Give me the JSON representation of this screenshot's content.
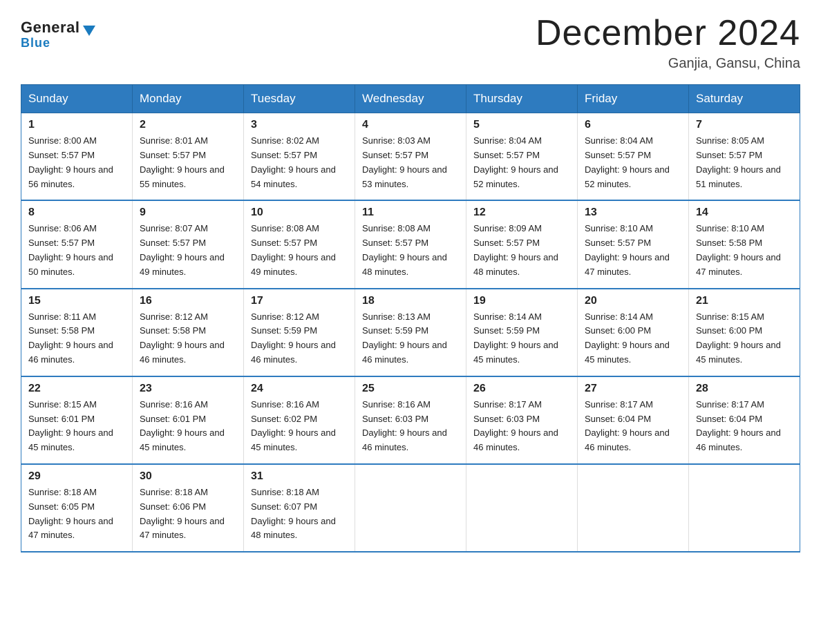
{
  "logo": {
    "general": "General",
    "blue": "Blue"
  },
  "title": "December 2024",
  "subtitle": "Ganjia, Gansu, China",
  "days_of_week": [
    "Sunday",
    "Monday",
    "Tuesday",
    "Wednesday",
    "Thursday",
    "Friday",
    "Saturday"
  ],
  "weeks": [
    [
      {
        "day": "1",
        "sunrise": "8:00 AM",
        "sunset": "5:57 PM",
        "daylight": "9 hours and 56 minutes."
      },
      {
        "day": "2",
        "sunrise": "8:01 AM",
        "sunset": "5:57 PM",
        "daylight": "9 hours and 55 minutes."
      },
      {
        "day": "3",
        "sunrise": "8:02 AM",
        "sunset": "5:57 PM",
        "daylight": "9 hours and 54 minutes."
      },
      {
        "day": "4",
        "sunrise": "8:03 AM",
        "sunset": "5:57 PM",
        "daylight": "9 hours and 53 minutes."
      },
      {
        "day": "5",
        "sunrise": "8:04 AM",
        "sunset": "5:57 PM",
        "daylight": "9 hours and 52 minutes."
      },
      {
        "day": "6",
        "sunrise": "8:04 AM",
        "sunset": "5:57 PM",
        "daylight": "9 hours and 52 minutes."
      },
      {
        "day": "7",
        "sunrise": "8:05 AM",
        "sunset": "5:57 PM",
        "daylight": "9 hours and 51 minutes."
      }
    ],
    [
      {
        "day": "8",
        "sunrise": "8:06 AM",
        "sunset": "5:57 PM",
        "daylight": "9 hours and 50 minutes."
      },
      {
        "day": "9",
        "sunrise": "8:07 AM",
        "sunset": "5:57 PM",
        "daylight": "9 hours and 49 minutes."
      },
      {
        "day": "10",
        "sunrise": "8:08 AM",
        "sunset": "5:57 PM",
        "daylight": "9 hours and 49 minutes."
      },
      {
        "day": "11",
        "sunrise": "8:08 AM",
        "sunset": "5:57 PM",
        "daylight": "9 hours and 48 minutes."
      },
      {
        "day": "12",
        "sunrise": "8:09 AM",
        "sunset": "5:57 PM",
        "daylight": "9 hours and 48 minutes."
      },
      {
        "day": "13",
        "sunrise": "8:10 AM",
        "sunset": "5:57 PM",
        "daylight": "9 hours and 47 minutes."
      },
      {
        "day": "14",
        "sunrise": "8:10 AM",
        "sunset": "5:58 PM",
        "daylight": "9 hours and 47 minutes."
      }
    ],
    [
      {
        "day": "15",
        "sunrise": "8:11 AM",
        "sunset": "5:58 PM",
        "daylight": "9 hours and 46 minutes."
      },
      {
        "day": "16",
        "sunrise": "8:12 AM",
        "sunset": "5:58 PM",
        "daylight": "9 hours and 46 minutes."
      },
      {
        "day": "17",
        "sunrise": "8:12 AM",
        "sunset": "5:59 PM",
        "daylight": "9 hours and 46 minutes."
      },
      {
        "day": "18",
        "sunrise": "8:13 AM",
        "sunset": "5:59 PM",
        "daylight": "9 hours and 46 minutes."
      },
      {
        "day": "19",
        "sunrise": "8:14 AM",
        "sunset": "5:59 PM",
        "daylight": "9 hours and 45 minutes."
      },
      {
        "day": "20",
        "sunrise": "8:14 AM",
        "sunset": "6:00 PM",
        "daylight": "9 hours and 45 minutes."
      },
      {
        "day": "21",
        "sunrise": "8:15 AM",
        "sunset": "6:00 PM",
        "daylight": "9 hours and 45 minutes."
      }
    ],
    [
      {
        "day": "22",
        "sunrise": "8:15 AM",
        "sunset": "6:01 PM",
        "daylight": "9 hours and 45 minutes."
      },
      {
        "day": "23",
        "sunrise": "8:16 AM",
        "sunset": "6:01 PM",
        "daylight": "9 hours and 45 minutes."
      },
      {
        "day": "24",
        "sunrise": "8:16 AM",
        "sunset": "6:02 PM",
        "daylight": "9 hours and 45 minutes."
      },
      {
        "day": "25",
        "sunrise": "8:16 AM",
        "sunset": "6:03 PM",
        "daylight": "9 hours and 46 minutes."
      },
      {
        "day": "26",
        "sunrise": "8:17 AM",
        "sunset": "6:03 PM",
        "daylight": "9 hours and 46 minutes."
      },
      {
        "day": "27",
        "sunrise": "8:17 AM",
        "sunset": "6:04 PM",
        "daylight": "9 hours and 46 minutes."
      },
      {
        "day": "28",
        "sunrise": "8:17 AM",
        "sunset": "6:04 PM",
        "daylight": "9 hours and 46 minutes."
      }
    ],
    [
      {
        "day": "29",
        "sunrise": "8:18 AM",
        "sunset": "6:05 PM",
        "daylight": "9 hours and 47 minutes."
      },
      {
        "day": "30",
        "sunrise": "8:18 AM",
        "sunset": "6:06 PM",
        "daylight": "9 hours and 47 minutes."
      },
      {
        "day": "31",
        "sunrise": "8:18 AM",
        "sunset": "6:07 PM",
        "daylight": "9 hours and 48 minutes."
      },
      null,
      null,
      null,
      null
    ]
  ]
}
